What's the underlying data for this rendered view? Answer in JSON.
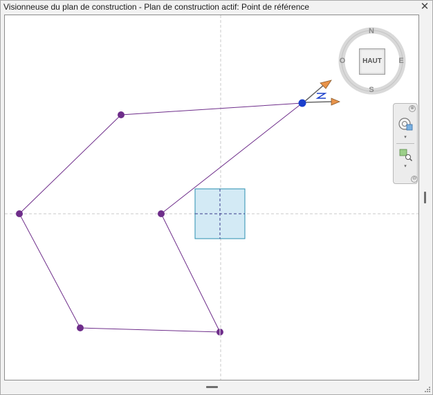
{
  "window": {
    "title": "Visionneuse du plan de construction - Plan de construction actif: Point de référence",
    "close_label": "✕"
  },
  "viewcube": {
    "face_label": "HAUT",
    "north": "N",
    "south": "S",
    "east": "E",
    "west": "O"
  },
  "navbar": {
    "close_label": "⊗",
    "more_label": "▾",
    "collapse_label": "⊖"
  },
  "colors": {
    "path_line": "#6e2d8a",
    "point": "#6e2d8a",
    "active_point": "#1a3fcc",
    "reference_plane_fill": "#d3eaf5",
    "reference_plane_stroke": "#2a8fb0",
    "axis_x": "#d98a4a",
    "axis_y": "#d98a4a",
    "guide_line": "#c8c8c8"
  },
  "icons": {
    "close": "close-icon",
    "steering_wheel": "steering-wheel-icon",
    "zoom_region": "zoom-region-icon",
    "work_plane": "work-plane-icon"
  }
}
